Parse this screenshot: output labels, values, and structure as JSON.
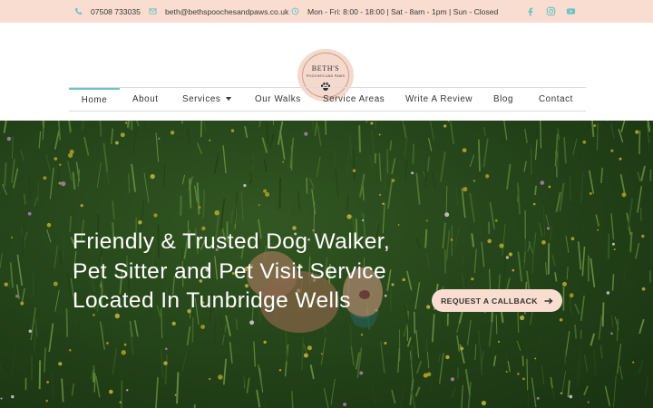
{
  "topbar": {
    "phone": "07508 733035",
    "email": "beth@bethspoochesandpaws.co.uk",
    "hours": "Mon - Fri: 8:00 - 18:00 | Sat - 8am - 1pm | Sun - Closed",
    "icons": {
      "phone": "phone-icon",
      "email": "envelope-icon",
      "hours": "clock-icon"
    },
    "social": [
      "facebook-icon",
      "instagram-icon",
      "youtube-icon"
    ]
  },
  "logo": {
    "title": "BETH'S",
    "subtitle": "POOCHES AND PAWS",
    "icon": "paw-icon"
  },
  "nav": {
    "items": [
      {
        "label": "Home",
        "active": true
      },
      {
        "label": "About"
      },
      {
        "label": "Services",
        "has_dropdown": true
      },
      {
        "label": "Our Walks"
      },
      {
        "label": "Service Areas"
      },
      {
        "label": "Write A Review"
      },
      {
        "label": "Blog"
      },
      {
        "label": "Contact"
      }
    ]
  },
  "hero": {
    "title": "Friendly & Trusted Dog Walker, Pet Sitter and Pet Visit Service Located In Tunbridge Wells",
    "cta_label": "REQUEST A CALLBACK",
    "cta_icon": "arrow-right-icon"
  },
  "colors": {
    "accent": "#6bc3c8",
    "topbar_bg": "#f9ddd0",
    "cta_bg": "#f9ddd0",
    "text": "#333333"
  }
}
